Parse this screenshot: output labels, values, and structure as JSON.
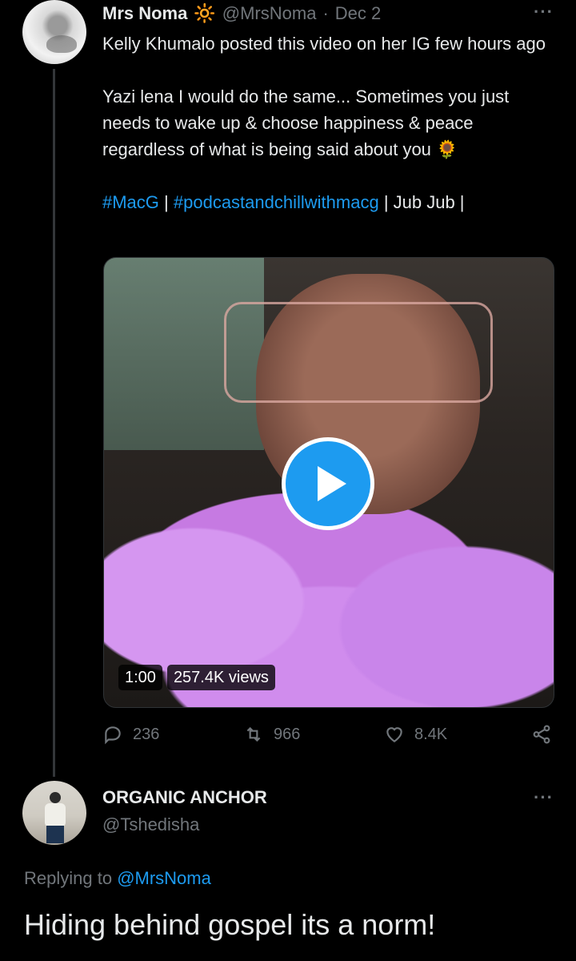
{
  "tweet": {
    "author_name": "Mrs Noma",
    "author_emoji": "🔆",
    "handle": "@MrsNoma",
    "separator": "·",
    "date": "Dec 2",
    "more": "···",
    "line1": "Kelly Khumalo posted this video on her IG few hours ago",
    "line2": "Yazi lena I would do the same... Sometimes you just needs to wake up & choose happiness & peace regardless of what is being said about you",
    "line2_emoji": "🌻",
    "hashtag1": "#MacG",
    "sep1": " | ",
    "hashtag2": "#podcastandchillwithmacg",
    "tail": " | Jub Jub |",
    "video": {
      "duration": "1:00",
      "views": "257.4K views"
    },
    "actions": {
      "replies": "236",
      "retweets": "966",
      "likes": "8.4K"
    }
  },
  "reply": {
    "author_name": "ORGANIC ANCHOR",
    "handle": "@Tshedisha",
    "more": "···",
    "replying_prefix": "Replying to ",
    "replying_to": "@MrsNoma",
    "text": "Hiding behind gospel its a norm!"
  },
  "colors": {
    "background": "#000000",
    "text": "#e7e9ea",
    "muted": "#71767b",
    "accent": "#1d9bf0"
  }
}
